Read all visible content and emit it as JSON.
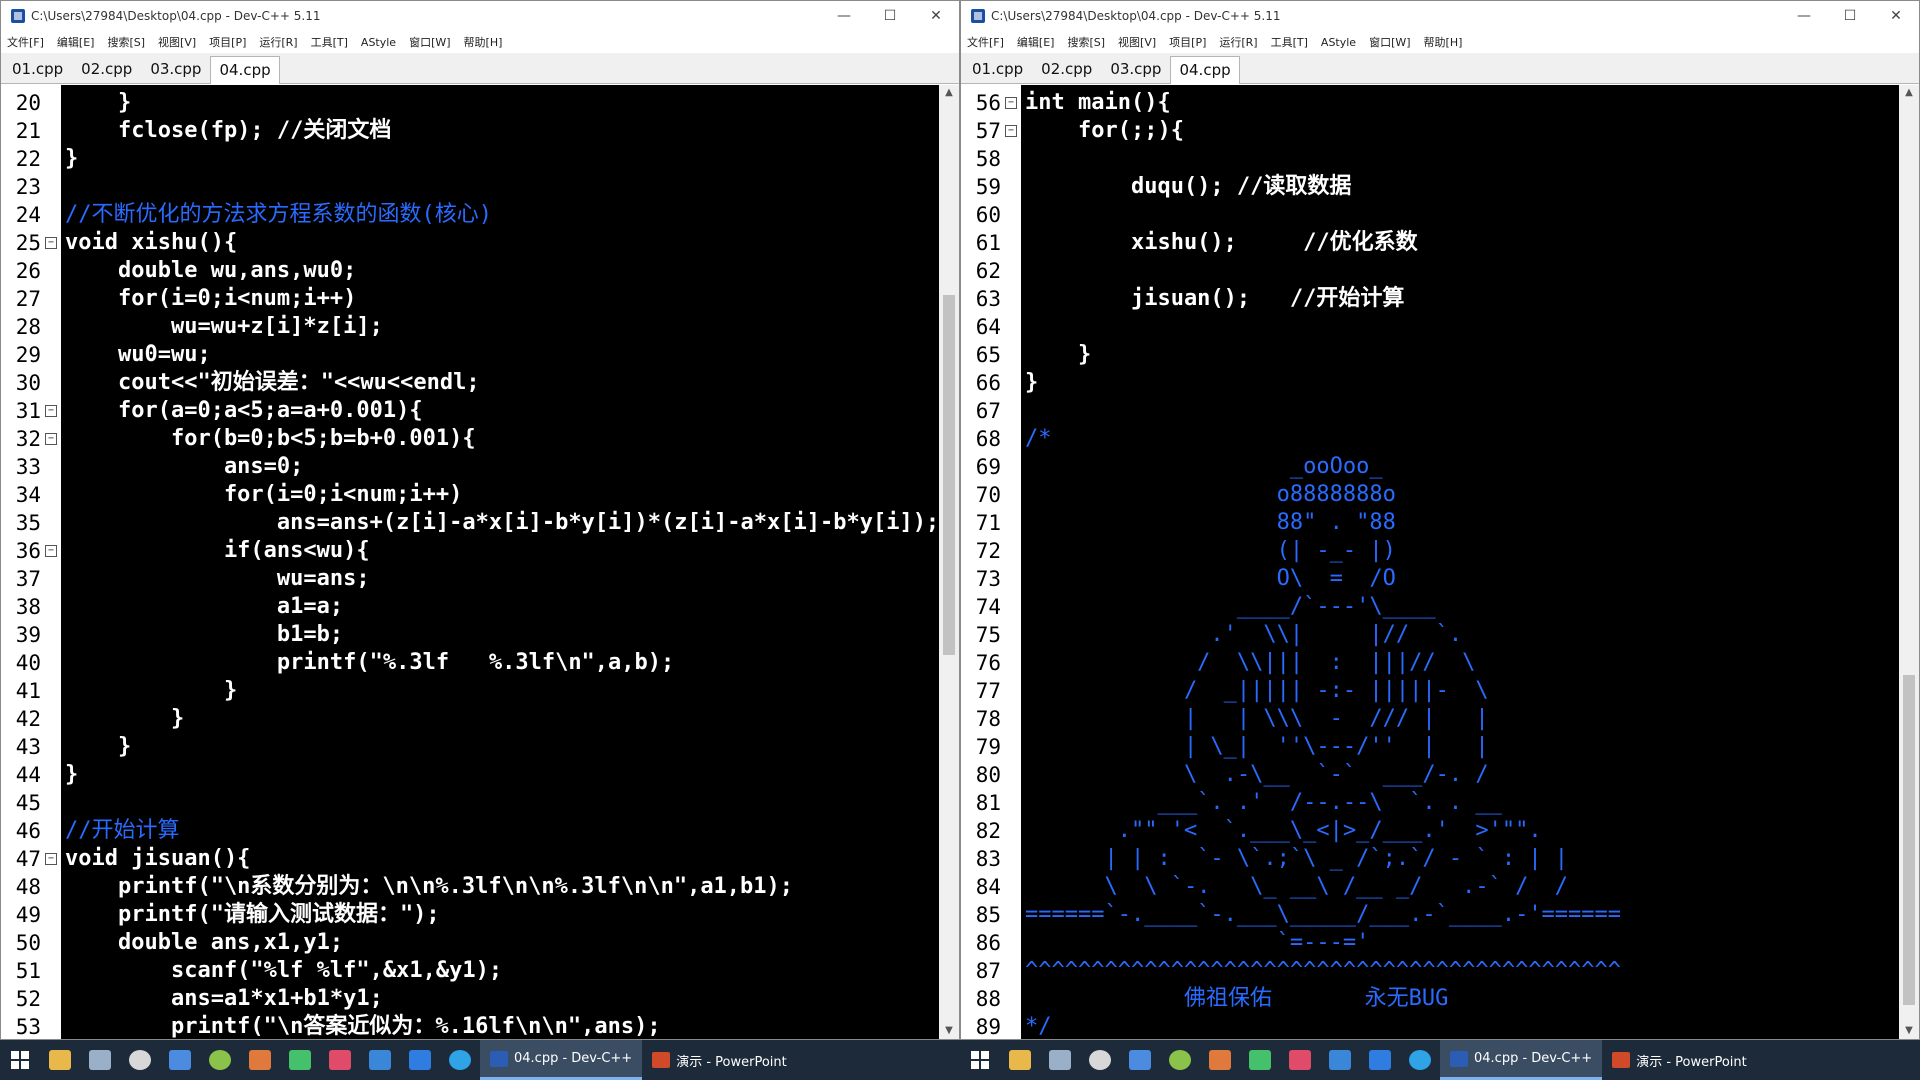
{
  "left": {
    "title": "C:\\Users\\27984\\Desktop\\04.cpp - Dev-C++ 5.11",
    "tabs": [
      "01.cpp",
      "02.cpp",
      "03.cpp",
      "04.cpp"
    ],
    "lines": [
      [
        "20",
        "    }"
      ],
      [
        "21",
        "    fclose(fp); //关闭文档"
      ],
      [
        "22",
        "}"
      ],
      [
        "23",
        ""
      ],
      [
        "24",
        "//不断优化的方法求方程系数的函数(核心)"
      ],
      [
        "25",
        "void xishu(){"
      ],
      [
        "26",
        "    double wu,ans,wu0;"
      ],
      [
        "27",
        "    for(i=0;i<num;i++)"
      ],
      [
        "28",
        "        wu=wu+z[i]*z[i];"
      ],
      [
        "29",
        "    wu0=wu;"
      ],
      [
        "30",
        "    cout<<\"初始误差：\"<<wu<<endl;"
      ],
      [
        "31",
        "    for(a=0;a<5;a=a+0.001){"
      ],
      [
        "32",
        "        for(b=0;b<5;b=b+0.001){"
      ],
      [
        "33",
        "            ans=0;"
      ],
      [
        "34",
        "            for(i=0;i<num;i++)"
      ],
      [
        "35",
        "                ans=ans+(z[i]-a*x[i]-b*y[i])*(z[i]-a*x[i]-b*y[i]);"
      ],
      [
        "36",
        "            if(ans<wu){"
      ],
      [
        "37",
        "                wu=ans;"
      ],
      [
        "38",
        "                a1=a;"
      ],
      [
        "39",
        "                b1=b;"
      ],
      [
        "40",
        "                printf(\"%.3lf   %.3lf\\n\",a,b);"
      ],
      [
        "41",
        "            }"
      ],
      [
        "42",
        "        }"
      ],
      [
        "43",
        "    }"
      ],
      [
        "44",
        "}"
      ],
      [
        "45",
        ""
      ],
      [
        "46",
        "//开始计算"
      ],
      [
        "47",
        "void jisuan(){"
      ],
      [
        "48",
        "    printf(\"\\n系数分别为：\\n\\n%.3lf\\n\\n%.3lf\\n\\n\",a1,b1);"
      ],
      [
        "49",
        "    printf(\"请输入测试数据：\");"
      ],
      [
        "50",
        "    double ans,x1,y1;"
      ],
      [
        "51",
        "        scanf(\"%lf %lf\",&x1,&y1);"
      ],
      [
        "52",
        "        ans=a1*x1+b1*y1;"
      ],
      [
        "53",
        "        printf(\"\\n答案近似为：%.16lf\\n\\n\",ans);"
      ]
    ]
  },
  "right": {
    "title": "C:\\Users\\27984\\Desktop\\04.cpp - Dev-C++ 5.11",
    "tabs": [
      "01.cpp",
      "02.cpp",
      "03.cpp",
      "04.cpp"
    ],
    "lines": [
      [
        "56",
        "int main(){"
      ],
      [
        "57",
        "    for(;;){"
      ],
      [
        "58",
        ""
      ],
      [
        "59",
        "        duqu(); //读取数据"
      ],
      [
        "60",
        ""
      ],
      [
        "61",
        "        xishu();     //优化系数"
      ],
      [
        "62",
        ""
      ],
      [
        "63",
        "        jisuan();   //开始计算"
      ],
      [
        "64",
        ""
      ],
      [
        "65",
        "    }"
      ],
      [
        "66",
        "}"
      ],
      [
        "67",
        ""
      ],
      [
        "68",
        "/*"
      ],
      [
        "69",
        "                    _ooOoo_"
      ],
      [
        "70",
        "                   o8888888o"
      ],
      [
        "71",
        "                   88\" . \"88"
      ],
      [
        "72",
        "                   (| -_- |)"
      ],
      [
        "73",
        "                   O\\  =  /O"
      ],
      [
        "74",
        "                ____/`---'\\____"
      ],
      [
        "75",
        "              .'  \\\\|     |//  `."
      ],
      [
        "76",
        "             /  \\\\|||  :  |||//  \\"
      ],
      [
        "77",
        "            /  _||||| -:- |||||-  \\"
      ],
      [
        "78",
        "            |   | \\\\\\  -  /// |   |"
      ],
      [
        "79",
        "            | \\_|  ''\\---/''  |   |"
      ],
      [
        "80",
        "            \\  .-\\__  `-`  ___/-. /"
      ],
      [
        "81",
        "          ___`. .'  /--.--\\  `. . __"
      ],
      [
        "82",
        "       .\"\" '<  `.___\\_<|>_/___.'  >'\"\"."
      ],
      [
        "83",
        "      | | :  `- \\`.;`\\ _ /`;.`/ - ` : | |"
      ],
      [
        "84",
        "      \\  \\ `-.   \\_ __\\ /__ _/   .-` /  /"
      ],
      [
        "85",
        "======`-.____`-.___\\_____/___.-`____.-'======"
      ],
      [
        "86",
        "                   `=---='"
      ],
      [
        "87",
        "^^^^^^^^^^^^^^^^^^^^^^^^^^^^^^^^^^^^^^^^^^^^^"
      ],
      [
        "88",
        "            佛祖保佑       永无BUG"
      ],
      [
        "89",
        "*/"
      ]
    ]
  },
  "menu": [
    "文件[F]",
    "编辑[E]",
    "搜索[S]",
    "视图[V]",
    "项目[P]",
    "运行[R]",
    "工具[T]",
    "AStyle",
    "窗口[W]",
    "帮助[H]"
  ],
  "taskbar": {
    "left_apps": [
      "04.cpp - Dev-C++",
      "演示 - PowerPoint"
    ],
    "right_apps": [
      "04.cpp - Dev-C++",
      "演示 - PowerPoint"
    ]
  }
}
